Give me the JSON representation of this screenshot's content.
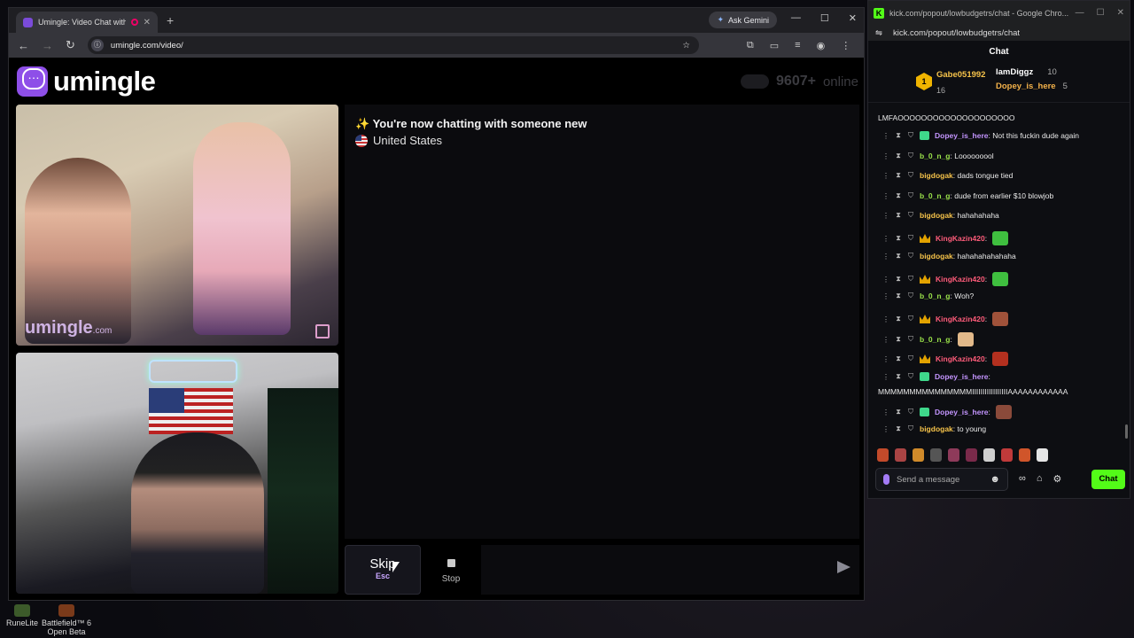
{
  "left_browser": {
    "tab_title": "Umingle: Video Chat with S",
    "ask_gemini": "Ask Gemini",
    "url": "umingle.com/video/"
  },
  "umingle": {
    "logo_text": "umingle",
    "online_count": "9607+",
    "online_label": "online",
    "stranger_watermark": "umingle",
    "stranger_watermark_suffix": ".com",
    "status_line": "✨ You're now chatting with someone new",
    "country": "United States",
    "skip_label": "Skip",
    "skip_hint": "Esc",
    "stop_label": "Stop"
  },
  "desktop": {
    "icons": [
      {
        "label": "RuneLite"
      },
      {
        "label": "Battlefield™ 6 Open Beta"
      }
    ]
  },
  "kick": {
    "window_title": "kick.com/popout/lowbudgetrs/chat - Google Chro...",
    "url": "kick.com/popout/lowbudgetrs/chat",
    "header": "Chat",
    "gifters": [
      {
        "rank": "1",
        "name": "Gabe051992",
        "count": "16"
      },
      {
        "name": "IamDiggz",
        "count": "10"
      },
      {
        "name": "Dopey_is_here",
        "count": "5"
      }
    ],
    "top_line": "LMFAOOOOOOOOOOOOOOOOOOOO",
    "messages": [
      {
        "user": "Dopey_is_here",
        "text": ": Not this fuckin dude again",
        "color": "#c495ff",
        "badge": "sub"
      },
      {
        "user": "b_0_n_g",
        "text": ": Looooooool",
        "color": "#9be34a",
        "badge": ""
      },
      {
        "user": "bigdogak",
        "text": ": dads tongue tied",
        "color": "#f6c34a",
        "badge": ""
      },
      {
        "user": "b_0_n_g",
        "text": ": dude from earlier $10 blowjob",
        "color": "#9be34a",
        "badge": ""
      },
      {
        "user": "bigdogak",
        "text": ": hahahahaha",
        "color": "#f6c34a",
        "badge": ""
      },
      {
        "user": "KingKazin420",
        "text": ":",
        "color": "#ff5c7a",
        "badge": "crown",
        "emote": "#3fbf3f"
      },
      {
        "user": "bigdogak",
        "text": ": hahahahahahaha",
        "color": "#f6c34a",
        "badge": ""
      },
      {
        "user": "KingKazin420",
        "text": ":",
        "color": "#ff5c7a",
        "badge": "crown",
        "emote": "#3fbf3f"
      },
      {
        "user": "b_0_n_g",
        "text": ": Woh?",
        "color": "#9be34a",
        "badge": ""
      },
      {
        "user": "KingKazin420",
        "text": ":",
        "color": "#ff5c7a",
        "badge": "crown",
        "emote": "#a0523a"
      },
      {
        "user": "b_0_n_g",
        "text": ":",
        "color": "#9be34a",
        "badge": "",
        "emote": "#e2b98a"
      },
      {
        "user": "KingKazin420",
        "text": ":",
        "color": "#ff5c7a",
        "badge": "crown",
        "emote": "#b3301f"
      },
      {
        "user": "Dopey_is_here",
        "text": ":",
        "color": "#c495ff",
        "badge": "sub"
      },
      {
        "user": "Dopey_is_here",
        "text": ":",
        "color": "#c495ff",
        "badge": "sub",
        "emote": "#8a4a3a"
      },
      {
        "user": "bigdogak",
        "text": ": to young",
        "color": "#f6c34a",
        "badge": ""
      }
    ],
    "continuation": "MMMMMMMMMMMMMMMIIIIIIIIIIIIIIIIIAAAAAAAAAAAA",
    "input_placeholder": "Send a message",
    "chat_button": "Chat"
  }
}
